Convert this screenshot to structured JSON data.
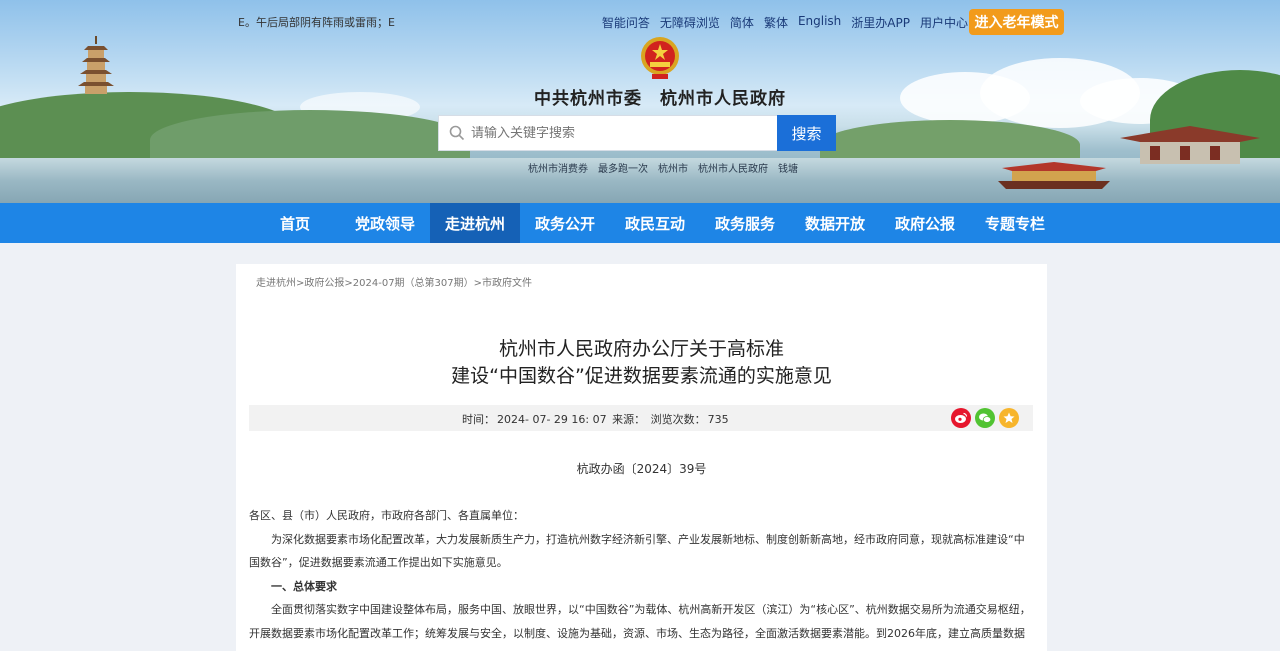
{
  "header": {
    "ticker": "E。午后局部阴有阵雨或雷雨；E",
    "top_links": [
      "智能问答",
      "无障碍浏览",
      "简体",
      "繁体",
      "English",
      "浙里办APP",
      "用户中心"
    ],
    "elder_mode": "进入老年模式",
    "site_title": "中共杭州市委　杭州市人民政府",
    "search": {
      "placeholder": "请输入关键字搜索",
      "button": "搜索"
    },
    "hot_words": [
      "杭州市消费券",
      "最多跑一次",
      "杭州市",
      "杭州市人民政府",
      "钱塘"
    ]
  },
  "nav": {
    "items": [
      "首页",
      "党政领导",
      "走进杭州",
      "政务公开",
      "政民互动",
      "政务服务",
      "数据开放",
      "政府公报",
      "专题专栏"
    ],
    "active_index": 2
  },
  "breadcrumb": [
    "走进杭州",
    ">政府公报",
    ">2024-07期（总第307期）",
    ">市政府文件"
  ],
  "article": {
    "title_line1": "杭州市人民政府办公厅关于高标准",
    "title_line2": "建设“中国数谷”促进数据要素流通的实施意见",
    "meta": {
      "time_label": "时间：",
      "time_value": "2024- 07- 29 16: 07",
      "source_label": "来源：",
      "views_label": "浏览次数：",
      "views_value": "735"
    },
    "share_icons": [
      "weibo-icon",
      "wechat-icon",
      "favorite-icon"
    ],
    "doc_number": "杭政办函〔2024〕39号",
    "paragraphs": [
      "各区、县（市）人民政府，市政府各部门、各直属单位：",
      "为深化数据要素市场化配置改革，大力发展新质生产力，打造杭州数字经济新引擎、产业发展新地标、制度创新新高地，经市政府同意，现就高标准建设“中国数谷”，促进数据要素流通工作提出如下实施意见。",
      "一、总体要求",
      "全面贯彻落实数字中国建设整体布局，服务中国、放眼世界，以“中国数谷”为载体、杭州高新开发区（滨江）为“核心区”、杭州数据交易所为流通交易枢纽，开展数据要素市场化配置改革工作；统筹发展与安全，以制度、设施为基础，资源、市场、生态为路径，全面激活数据要素潜能。到2026年底，建立高质量数据"
    ]
  },
  "colors": {
    "nav_bg": "#1e85e6",
    "nav_active": "#1561b6",
    "search_button": "#1b6fd8",
    "elder_button": "#f29b1b",
    "weibo": "#e6162d",
    "wechat": "#51c332",
    "favorite": "#f7b52c"
  }
}
